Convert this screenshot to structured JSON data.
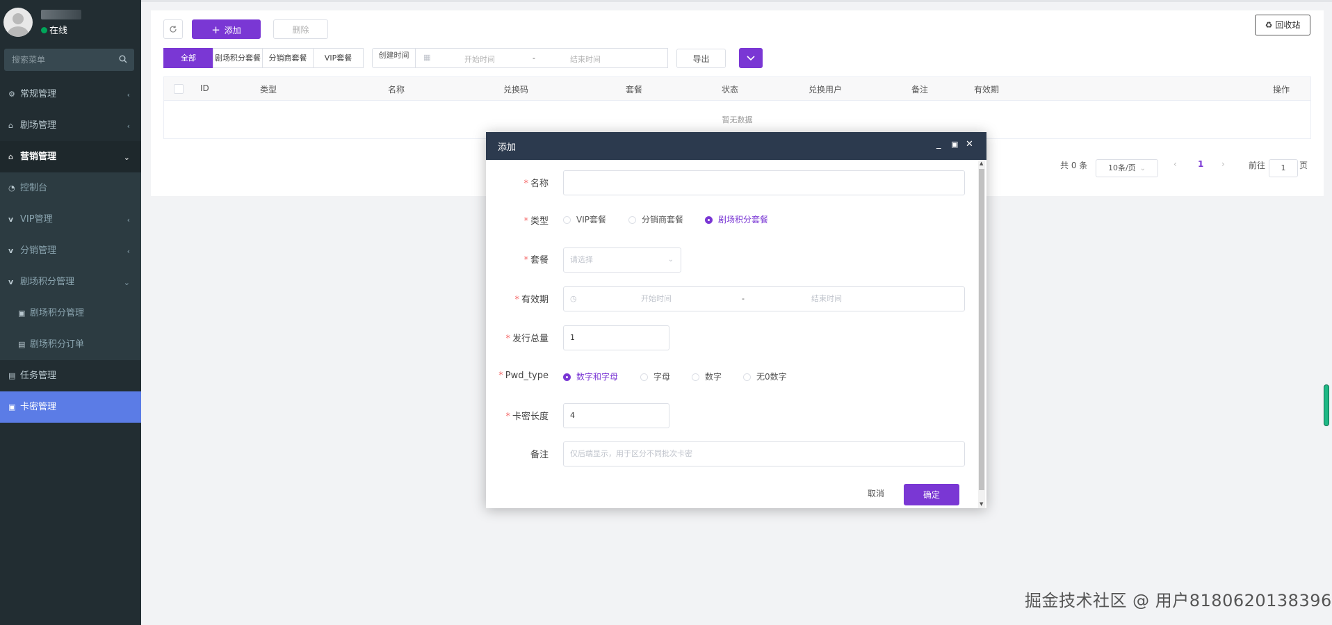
{
  "sidebar": {
    "status": "在线",
    "search_placeholder": "搜索菜单",
    "items": [
      {
        "label": "常规管理",
        "arrow": "‹"
      },
      {
        "label": "剧场管理",
        "arrow": "‹"
      },
      {
        "label": "营销管理",
        "arrow": "⌄"
      },
      {
        "label": "控制台"
      },
      {
        "label": "VIP管理",
        "arrow": "‹"
      },
      {
        "label": "分销管理",
        "arrow": "‹"
      },
      {
        "label": "剧场积分管理",
        "arrow": "⌄"
      },
      {
        "label": "剧场积分管理"
      },
      {
        "label": "剧场积分订单"
      },
      {
        "label": "任务管理"
      },
      {
        "label": "卡密管理"
      }
    ]
  },
  "toolbar": {
    "add_label": "添加",
    "delete_label": "删除",
    "recycle_label": "回收站",
    "export_label": "导出",
    "filters": [
      "全部",
      "剧场积分套餐",
      "分销商套餐",
      "VIP套餐"
    ],
    "created_time_label": "创建时间",
    "start_placeholder": "开始时间",
    "end_placeholder": "结束时间",
    "range_sep": "-"
  },
  "table": {
    "columns": [
      "ID",
      "类型",
      "名称",
      "兑换码",
      "套餐",
      "状态",
      "兑换用户",
      "备注",
      "有效期",
      "操作"
    ],
    "empty_text": "暂无数据"
  },
  "pager": {
    "total": "共 0 条",
    "page_size": "10条/页",
    "current": "1",
    "goto_label": "前往",
    "goto_value": "1",
    "page_suffix": "页"
  },
  "modal": {
    "title": "添加",
    "fields": {
      "name": {
        "label": "名称"
      },
      "type": {
        "label": "类型",
        "options": [
          "VIP套餐",
          "分销商套餐",
          "剧场积分套餐"
        ],
        "selected": 2
      },
      "package": {
        "label": "套餐",
        "placeholder": "请选择"
      },
      "validity": {
        "label": "有效期",
        "start_placeholder": "开始时间",
        "end_placeholder": "结束时间",
        "sep": "-"
      },
      "issue_total": {
        "label": "发行总量",
        "value": "1"
      },
      "pwd_type": {
        "label": "Pwd_type",
        "options": [
          "数字和字母",
          "字母",
          "数字",
          "无0数字"
        ],
        "selected": 0
      },
      "card_len": {
        "label": "卡密长度",
        "value": "4"
      },
      "remark": {
        "label": "备注",
        "placeholder": "仅后端显示，用于区分不同批次卡密"
      }
    },
    "cancel_label": "取消",
    "confirm_label": "确定"
  },
  "watermark": "掘金技术社区 @ 用户8180620138396",
  "colors": {
    "primary": "#7a37d4",
    "sidebar_bg": "#222d32",
    "active_item": "#5b7ce6",
    "modal_header": "#2c3a4e"
  }
}
